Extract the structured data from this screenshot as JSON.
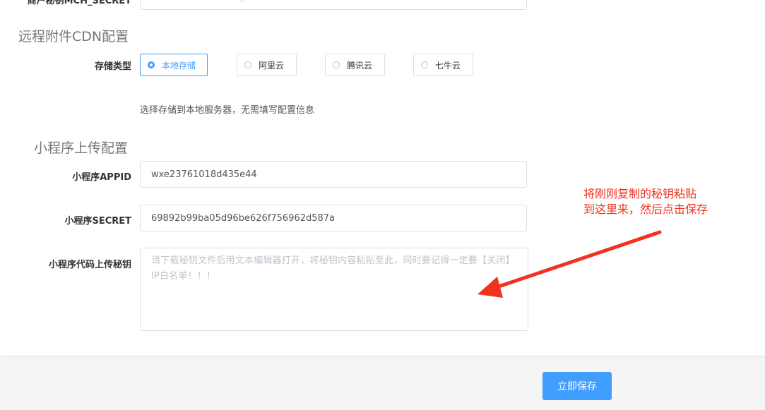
{
  "top_row": {
    "label": "商户秘钥MCH_SECRET",
    "placeholder": "请输入商户秘钥 MCH_SECRET"
  },
  "cdn_section": {
    "title": "远程附件CDN配置",
    "storage_label": "存储类型",
    "options": [
      "本地存储",
      "阿里云",
      "腾讯云",
      "七牛云"
    ],
    "selected": "本地存储",
    "helper_text": "选择存储到本地服务器，无需填写配置信息"
  },
  "miniprogram_section": {
    "title": "小程序上传配置",
    "appid_label": "小程序APPID",
    "appid_value": "wxe23761018d435e44",
    "secret_label": "小程序SECRET",
    "secret_value": "69892b99ba05d96be626f756962d587a",
    "key_label": "小程序代码上传秘钥",
    "key_placeholder": "请下载秘钥文件后用文本编辑器打开，将秘钥内容粘贴至此，同时要记得一定要【关闭】IP白名单！！！"
  },
  "annotation": {
    "line1": "将刚刚复制的秘钥粘贴",
    "line2": "到这里来，然后点击保存",
    "color": "#f0321e"
  },
  "footer": {
    "save_label": "立即保存"
  },
  "colors": {
    "accent": "#409eff",
    "annotation": "#f0321e"
  }
}
